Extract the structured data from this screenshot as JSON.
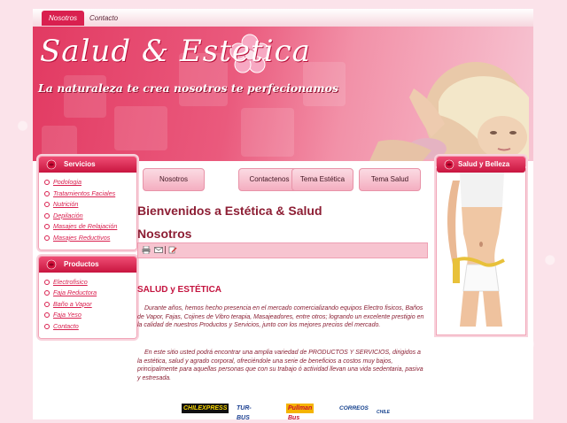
{
  "topnav": {
    "tabs": [
      {
        "label": "Nosotros",
        "active": true
      },
      {
        "label": "Contacto",
        "active": false
      }
    ]
  },
  "banner": {
    "title": "Salud & Estetica",
    "slogan": "La naturaleza te crea nosotros te perfecionamos"
  },
  "sidebar_left": {
    "services": {
      "title": "Servicios",
      "items": [
        "Podologia",
        "Tratamientos Faciales",
        "Nutrición",
        "Depilación",
        "Masajes de Relajación",
        "Masajes Reductivos"
      ]
    },
    "products": {
      "title": "Productos",
      "items": [
        "Electrofisico",
        "Faja Reductora",
        "Baño a Vapor",
        "Faja Yeso",
        "Contacto"
      ]
    }
  },
  "tabs": [
    "Nosotros",
    "Contactenos",
    "Tema Estética",
    "Tema Salud"
  ],
  "main": {
    "welcome": "Bienvenidos a Estética & Salud",
    "heading": "Nosotros",
    "toolbar": {
      "icons": [
        "print-icon",
        "email-icon",
        "edit-icon"
      ],
      "separator": "|"
    },
    "section_title": "SALUD y ESTÉTICA",
    "paragraph1": "Durante años, hemos hecho presencia en el mercado comercializando equipos Electro fisicos, Baños de Vapor, Fajas, Cojines de Vibro terapia, Masajeadores, entre otros; logrando un excelente prestigio en la calidad de nuestros Productos y Servicios, junto con los mejores precios del mercado.",
    "paragraph2": "En este sitio usted podrá encontrar una amplia variedad de PRODUCTOS Y SERVICIOS, dirigidos a la estética, salud y agrado corporal, ofreciéndole una serie de beneficios a costos muy bajos, principalmente para aquellas personas que con su trabajo ó actividad llevan una vida sedentaria, pasiva y estresada."
  },
  "sidebar_right": {
    "title": "Salud y Belleza"
  },
  "footer": {
    "logos": [
      "CHILEXPRESS",
      "TUR-BUS",
      "Pullman Bus",
      "CORREOS",
      "CHILE"
    ]
  },
  "colors": {
    "accent": "#d9204f",
    "heading": "#8d1e34",
    "page_bg": "#fbe3ea"
  }
}
